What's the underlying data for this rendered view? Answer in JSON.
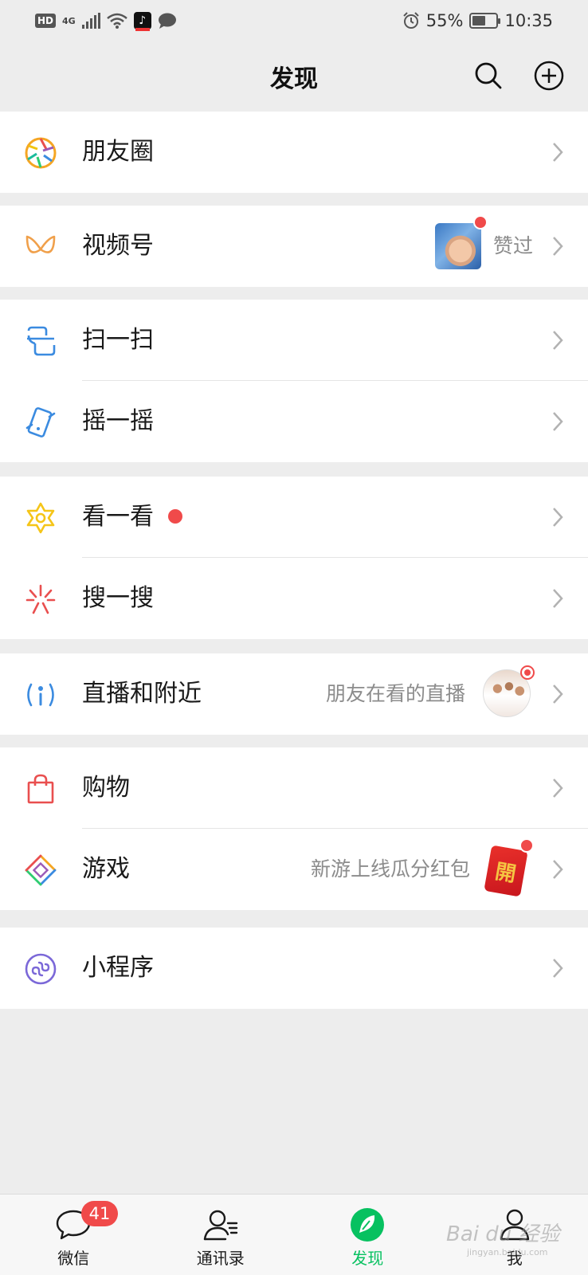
{
  "status_bar": {
    "hd": "HD",
    "network": "4G",
    "battery": "55%",
    "battery_level": 0.55,
    "time": "10:35"
  },
  "header": {
    "title": "发现",
    "search_icon": "search-icon",
    "add_icon": "plus-circle-icon"
  },
  "items": {
    "moments": {
      "label": "朋友圈"
    },
    "channels": {
      "label": "视频号",
      "sub": "赞过"
    },
    "scan": {
      "label": "扫一扫"
    },
    "shake": {
      "label": "摇一摇"
    },
    "top_stories": {
      "label": "看一看"
    },
    "search": {
      "label": "搜一搜"
    },
    "live_nearby": {
      "label": "直播和附近",
      "sub": "朋友在看的直播"
    },
    "shopping": {
      "label": "购物"
    },
    "games": {
      "label": "游戏",
      "sub": "新游上线瓜分红包",
      "packet_char": "開"
    },
    "mini_programs": {
      "label": "小程序"
    }
  },
  "tabbar": {
    "chats": {
      "label": "微信",
      "badge": "41"
    },
    "contacts": {
      "label": "通讯录"
    },
    "discover": {
      "label": "发现"
    },
    "me": {
      "label": "我"
    }
  },
  "watermark": {
    "text": "Bai du 经验",
    "sub": "jingyan.baidu.com"
  },
  "colors": {
    "accent": "#07c160",
    "badge": "#f04a4a",
    "background": "#ededed"
  }
}
